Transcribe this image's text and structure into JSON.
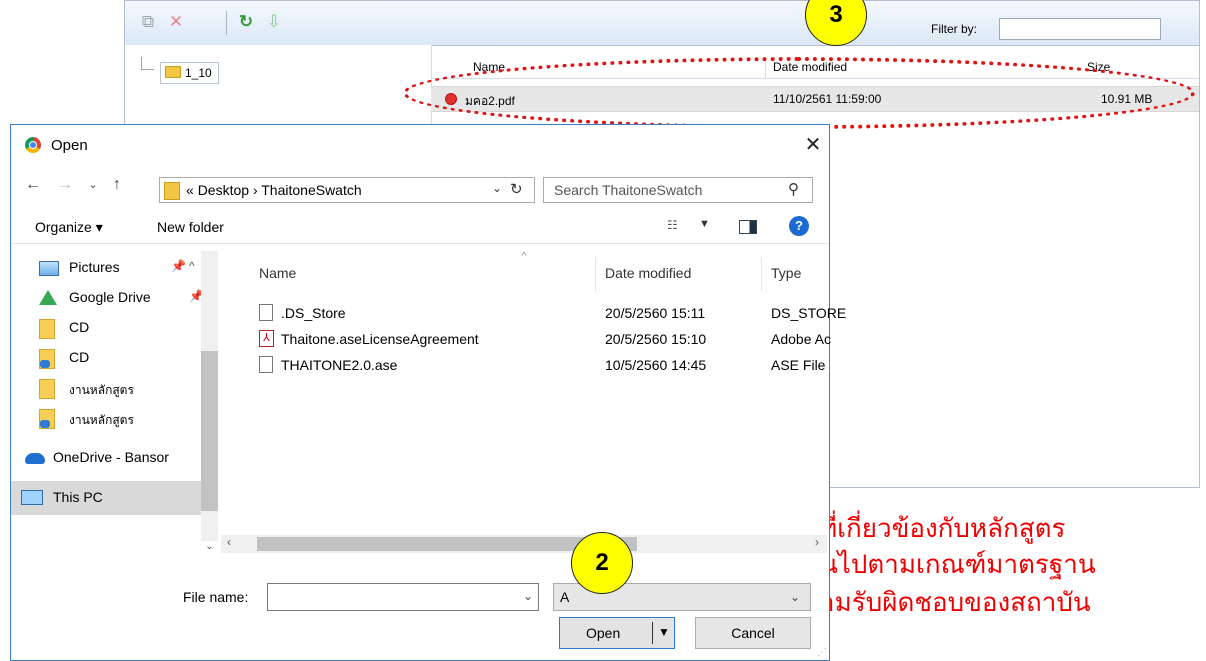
{
  "file_manager": {
    "toolbar": {
      "copy_icon": "copy-icon",
      "delete_icon": "x-icon",
      "refresh_icon": "refresh-icon",
      "download_icon": "down-arrow-icon",
      "filter_label": "Filter by:",
      "filter_value": ""
    },
    "tree": {
      "folder_name": "1_10"
    },
    "columns": {
      "name": "Name",
      "date_modified": "Date modified",
      "size": "Size"
    },
    "rows": [
      {
        "name": "มคอ2.pdf",
        "date_modified": "11/10/2561 11:59:00",
        "size": "10.91 MB"
      }
    ]
  },
  "callouts": {
    "step3": "3",
    "step2": "2"
  },
  "thai_text": {
    "line1": "ที่เกี่ยวข้องกับหลักสูตร",
    "line2": "นไปตามเกณฑ์มาตรฐาน",
    "line3": "ามรับผิดชอบของสถาบัน"
  },
  "dialog": {
    "title": "Open",
    "address": {
      "prefix": "«",
      "part1": "Desktop",
      "separator": "›",
      "part2": "ThaitoneSwatch"
    },
    "search_placeholder": "Search ThaitoneSwatch",
    "commands": {
      "organize": "Organize ▾",
      "new_folder": "New folder"
    },
    "nav_pane": [
      {
        "label": "Pictures",
        "icon": "pictures-icon",
        "pinned": true
      },
      {
        "label": "Google Drive",
        "icon": "google-drive-icon",
        "pinned": true
      },
      {
        "label": "CD",
        "icon": "folder-icon",
        "pinned": false
      },
      {
        "label": "CD",
        "icon": "cloud-folder-icon",
        "pinned": false
      },
      {
        "label": "งานหลักสูตร",
        "icon": "folder-icon",
        "pinned": false
      },
      {
        "label": "งานหลักสูตร",
        "icon": "cloud-folder-icon",
        "pinned": false
      },
      {
        "label": "OneDrive - Bansor",
        "icon": "onedrive-icon",
        "pinned": false
      },
      {
        "label": "This PC",
        "icon": "this-pc-icon",
        "pinned": false
      }
    ],
    "columns": {
      "name": "Name",
      "date_modified": "Date modified",
      "type": "Type"
    },
    "files": [
      {
        "name": ".DS_Store",
        "date_modified": "20/5/2560 15:11",
        "type": "DS_STORE",
        "icon": "document-icon"
      },
      {
        "name": "Thaitone.aseLicenseAgreement",
        "date_modified": "20/5/2560 15:10",
        "type": "Adobe Ac",
        "icon": "pdf-icon"
      },
      {
        "name": "THAITONE2.0.ase",
        "date_modified": "10/5/2560 14:45",
        "type": "ASE File",
        "icon": "document-icon"
      }
    ],
    "file_name_label": "File name:",
    "file_name_value": "",
    "file_type_value": "A",
    "open_label": "Open",
    "cancel_label": "Cancel",
    "colors": {
      "accent": "#2b7bd0",
      "selected_nav": "#cce4f7"
    }
  }
}
